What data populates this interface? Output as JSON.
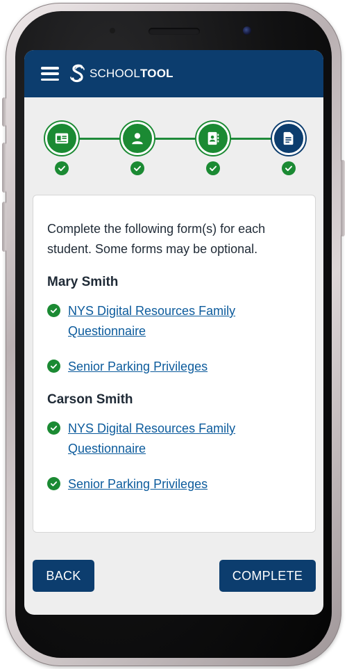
{
  "header": {
    "logo_text_light": "SCHOOL",
    "logo_text_bold": "TOOL",
    "brand_color": "#0c3d6e"
  },
  "stepper": {
    "steps": [
      {
        "icon": "id-card-icon",
        "status": "complete"
      },
      {
        "icon": "person-icon",
        "status": "complete"
      },
      {
        "icon": "contact-book-icon",
        "status": "complete"
      },
      {
        "icon": "document-icon",
        "status": "current"
      }
    ],
    "complete_color": "#1b8a33"
  },
  "main": {
    "intro": "Complete the following form(s) for each student. Some forms may be optional.",
    "students": [
      {
        "name": "Mary Smith",
        "forms": [
          {
            "label": "NYS Digital Resources Family Questionnaire",
            "status": "complete"
          },
          {
            "label": "Senior Parking Privileges",
            "status": "complete"
          }
        ]
      },
      {
        "name": "Carson Smith",
        "forms": [
          {
            "label": "NYS Digital Resources Family Questionnaire",
            "status": "complete"
          },
          {
            "label": "Senior Parking Privileges",
            "status": "complete"
          }
        ]
      }
    ]
  },
  "footer": {
    "back_label": "BACK",
    "complete_label": "COMPLETE"
  }
}
